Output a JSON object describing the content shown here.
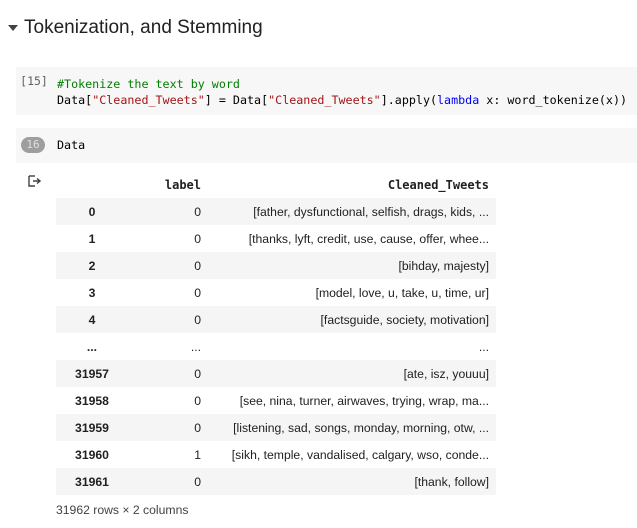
{
  "section": {
    "title": "Tokenization, and Stemming"
  },
  "cells": [
    {
      "execution_count": "[15]",
      "lines": [
        {
          "comment": "#Tokenize the text by word"
        },
        {
          "p1": "Data[",
          "s1": "\"Cleaned_Tweets\"",
          "p2": "] = Data[",
          "s2": "\"Cleaned_Tweets\"",
          "p3": "].apply(",
          "kw": "lambda",
          "p4": " x: word_tokenize(x))"
        }
      ]
    },
    {
      "execution_count": "16",
      "code": "Data"
    }
  ],
  "dataframe": {
    "columns": [
      "",
      "label",
      "Cleaned_Tweets"
    ],
    "rows": [
      {
        "index": "0",
        "label": "0",
        "tweets": "[father, dysfunctional, selfish, drags, kids, ..."
      },
      {
        "index": "1",
        "label": "0",
        "tweets": "[thanks, lyft, credit, use, cause, offer, whee..."
      },
      {
        "index": "2",
        "label": "0",
        "tweets": "[bihday, majesty]"
      },
      {
        "index": "3",
        "label": "0",
        "tweets": "[model, love, u, take, u, time, ur]"
      },
      {
        "index": "4",
        "label": "0",
        "tweets": "[factsguide, society, motivation]"
      },
      {
        "index": "...",
        "label": "...",
        "tweets": "..."
      },
      {
        "index": "31957",
        "label": "0",
        "tweets": "[ate, isz, youuu]"
      },
      {
        "index": "31958",
        "label": "0",
        "tweets": "[see, nina, turner, airwaves, trying, wrap, ma..."
      },
      {
        "index": "31959",
        "label": "0",
        "tweets": "[listening, sad, songs, monday, morning, otw, ..."
      },
      {
        "index": "31960",
        "label": "1",
        "tweets": "[sikh, temple, vandalised, calgary, wso, conde..."
      },
      {
        "index": "31961",
        "label": "0",
        "tweets": "[thank, follow]"
      }
    ],
    "shape_text": "31962 rows × 2 columns"
  }
}
